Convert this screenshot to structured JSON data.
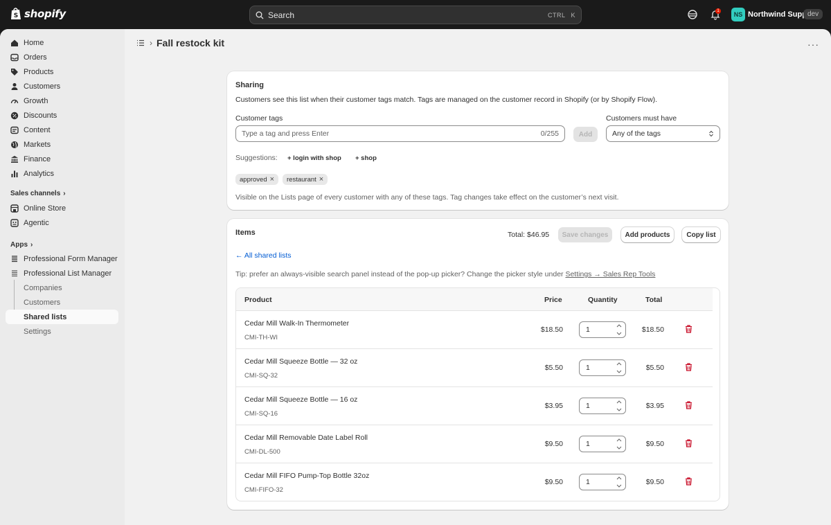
{
  "topbar": {
    "brand": "shopify",
    "search_placeholder": "Search",
    "shortcut_ctrl": "CTRL",
    "shortcut_key": "K",
    "notification_count": "1",
    "avatar_initials": "NS",
    "store_name": "Northwind Supply",
    "env_badge": "dev"
  },
  "sidebar": {
    "items": [
      {
        "label": "Home",
        "icon": "home-icon"
      },
      {
        "label": "Orders",
        "icon": "inbox-icon"
      },
      {
        "label": "Products",
        "icon": "tag-icon"
      },
      {
        "label": "Customers",
        "icon": "person-icon"
      },
      {
        "label": "Growth",
        "icon": "gauge-icon"
      },
      {
        "label": "Discounts",
        "icon": "discount-icon"
      },
      {
        "label": "Content",
        "icon": "content-icon"
      },
      {
        "label": "Markets",
        "icon": "globe-icon"
      },
      {
        "label": "Finance",
        "icon": "bank-icon"
      },
      {
        "label": "Analytics",
        "icon": "bar-chart-icon"
      }
    ],
    "sales_channels_label": "Sales channels",
    "channels": [
      {
        "label": "Online Store",
        "icon": "store-icon"
      },
      {
        "label": "Agentic",
        "icon": "agentic-icon"
      }
    ],
    "apps_label": "Apps",
    "apps": [
      {
        "label": "Professional Form Manager",
        "icon": "form-icon"
      },
      {
        "label": "Professional List Manager",
        "icon": "list-icon"
      }
    ],
    "sub_items": [
      "Companies",
      "Customers",
      "Shared lists",
      "Settings"
    ]
  },
  "page": {
    "title": "Fall restock kit"
  },
  "sharing": {
    "heading": "Sharing",
    "description": "Customers see this list when their customer tags match. Tags are managed on the customer record in Shopify (or by Shopify Flow).",
    "tags_label": "Customer tags",
    "tags_placeholder": "Type a tag and press Enter",
    "char_count": "0/255",
    "add_label": "Add",
    "must_have_label": "Customers must have",
    "must_have_value": "Any of the tags",
    "suggestions_label": "Suggestions:",
    "suggestions": [
      "+ login with shop",
      "+ shop"
    ],
    "tags": [
      "approved",
      "restaurant"
    ],
    "footer_note": "Visible on the Lists page of every customer with any of these tags. Tag changes take effect on the customer’s next visit."
  },
  "items": {
    "heading": "Items",
    "total": "Total: $46.95",
    "save_label": "Save changes",
    "add_products_label": "Add products",
    "copy_list_label": "Copy list",
    "back_link": "← All shared lists",
    "tip_text": "Tip: prefer an always-visible search panel instead of the pop-up picker? Change the picker style under ",
    "tip_link": "Settings → Sales Rep Tools",
    "columns": [
      "Product",
      "Price",
      "Quantity",
      "Total"
    ],
    "rows": [
      {
        "name": "Cedar Mill Walk-In Thermometer",
        "sku": "CMI-TH-WI",
        "price": "$18.50",
        "qty": "1",
        "total": "$18.50"
      },
      {
        "name": "Cedar Mill Squeeze Bottle — 32 oz",
        "sku": "CMI-SQ-32",
        "price": "$5.50",
        "qty": "1",
        "total": "$5.50"
      },
      {
        "name": "Cedar Mill Squeeze Bottle — 16 oz",
        "sku": "CMI-SQ-16",
        "price": "$3.95",
        "qty": "1",
        "total": "$3.95"
      },
      {
        "name": "Cedar Mill Removable Date Label Roll",
        "sku": "CMI-DL-500",
        "price": "$9.50",
        "qty": "1",
        "total": "$9.50"
      },
      {
        "name": "Cedar Mill FIFO Pump-Top Bottle 32oz",
        "sku": "CMI-FIFO-32",
        "price": "$9.50",
        "qty": "1",
        "total": "$9.50"
      }
    ]
  },
  "colors": {
    "topbar": "#1a1a1a",
    "link": "#005bd3",
    "danger": "#c70a24",
    "avatar": "#32cdbf"
  }
}
